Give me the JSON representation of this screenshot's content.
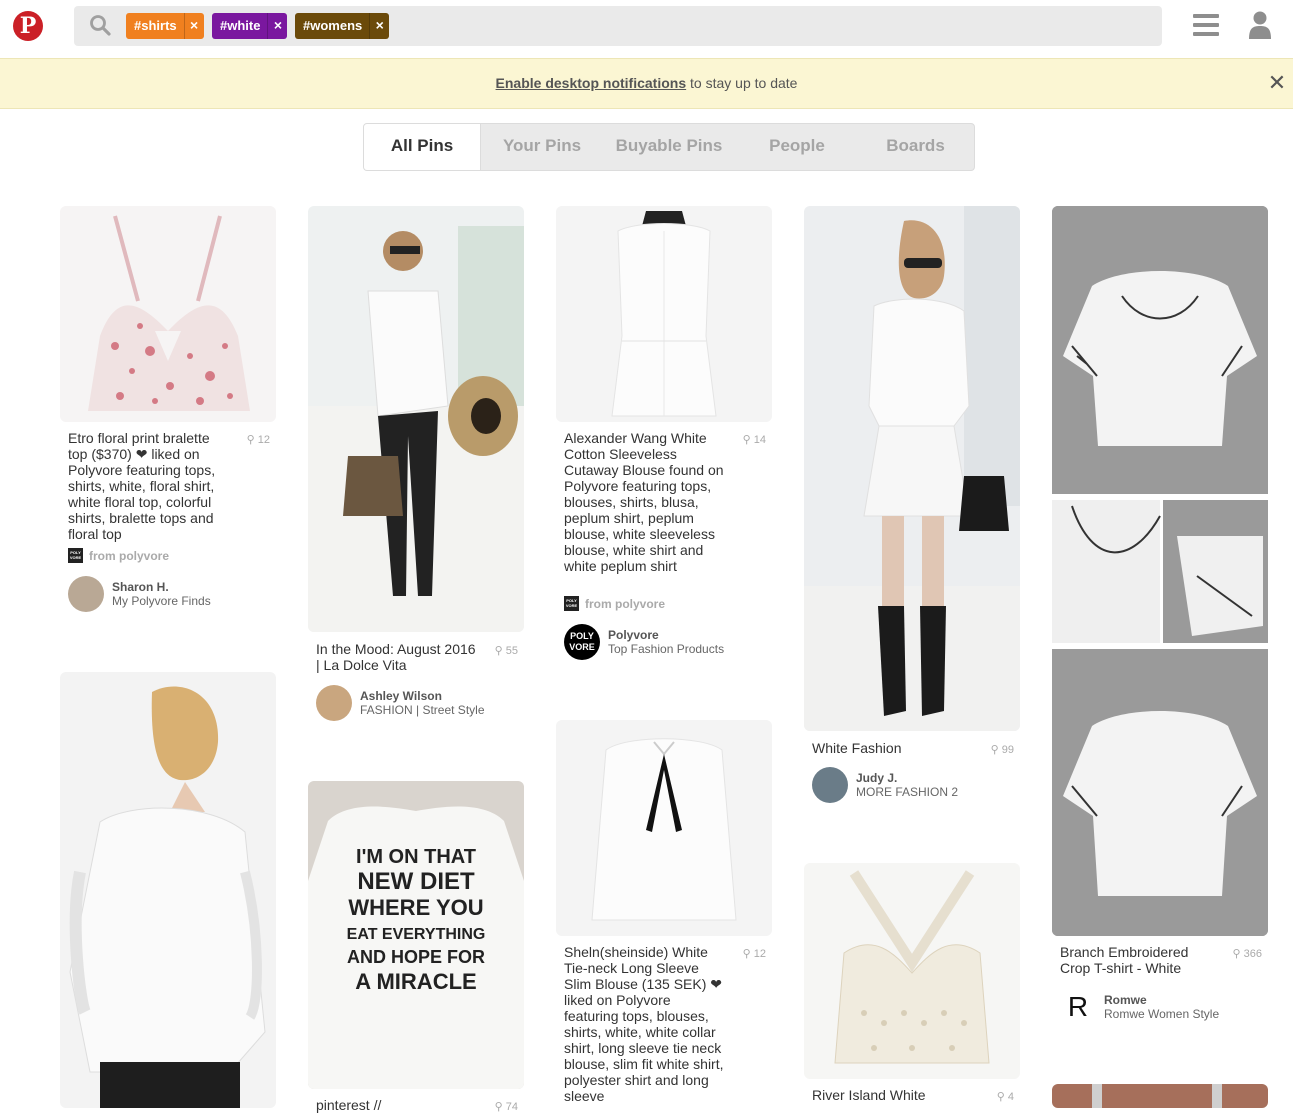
{
  "header": {
    "logo": "P",
    "tags": [
      {
        "label": "#shirts",
        "color": "#f0801f"
      },
      {
        "label": "#white",
        "color": "#7a179f"
      },
      {
        "label": "#womens",
        "color": "#6b4a0a"
      }
    ],
    "remove_glyph": "×"
  },
  "notice": {
    "link": "Enable desktop notifications",
    "text": " to stay up to date",
    "close": "✕"
  },
  "tabs": [
    "All Pins",
    "Your Pins",
    "Buyable Pins",
    "People",
    "Boards"
  ],
  "pins": [
    {
      "desc": "Etro floral print bralette top ($370) ❤ liked on Polyvore featuring tops, shirts, white, floral shirt, white floral top, colorful shirts, bralette tops and floral top",
      "count": "12",
      "source": "from polyvore",
      "pinner": "Sharon H.",
      "board": "My Polyvore Finds"
    },
    {
      "desc": "In the Mood: August 2016 | La Dolce Vita",
      "count": "55",
      "pinner": "Ashley Wilson",
      "board": "FASHION | Street Style"
    },
    {
      "desc": "Alexander Wang White Cotton Sleeveless Cutaway Blouse found on Polyvore featuring tops, blouses, shirts, blusa, peplum shirt, peplum blouse, white sleeveless blouse, white shirt and white peplum shirt",
      "count": "14",
      "source": "from polyvore",
      "pinner": "Polyvore",
      "board": "Top Fashion Products"
    },
    {
      "desc": "White Fashion",
      "count": "99",
      "pinner": "Judy J.",
      "board": "MORE FASHION 2"
    },
    {
      "desc": "Branch Embroidered Crop T-shirt - White",
      "count": "366",
      "pinner": "Romwe",
      "board": "Romwe Women Style"
    },
    {
      "desc": "pinterest //",
      "count": "74"
    },
    {
      "desc": "Sheln(sheinside) White Tie-neck Long Sleeve Slim Blouse (135 SEK) ❤ liked on Polyvore featuring tops, blouses, shirts, white, white collar shirt, long sleeve tie neck blouse, slim fit white shirt, polyester shirt and long sleeve",
      "count": "12"
    },
    {
      "desc": "River Island White",
      "count": "4"
    }
  ],
  "tshirt_text": [
    "I'M ON THAT",
    "NEW DIET",
    "WHERE YOU",
    "EAT EVERYTHING",
    "AND HOPE FOR",
    "A MIRACLE"
  ],
  "polyvore_avatar": "POLY VORE",
  "romwe_avatar": "R",
  "src_logo_text": "POLY VORE"
}
